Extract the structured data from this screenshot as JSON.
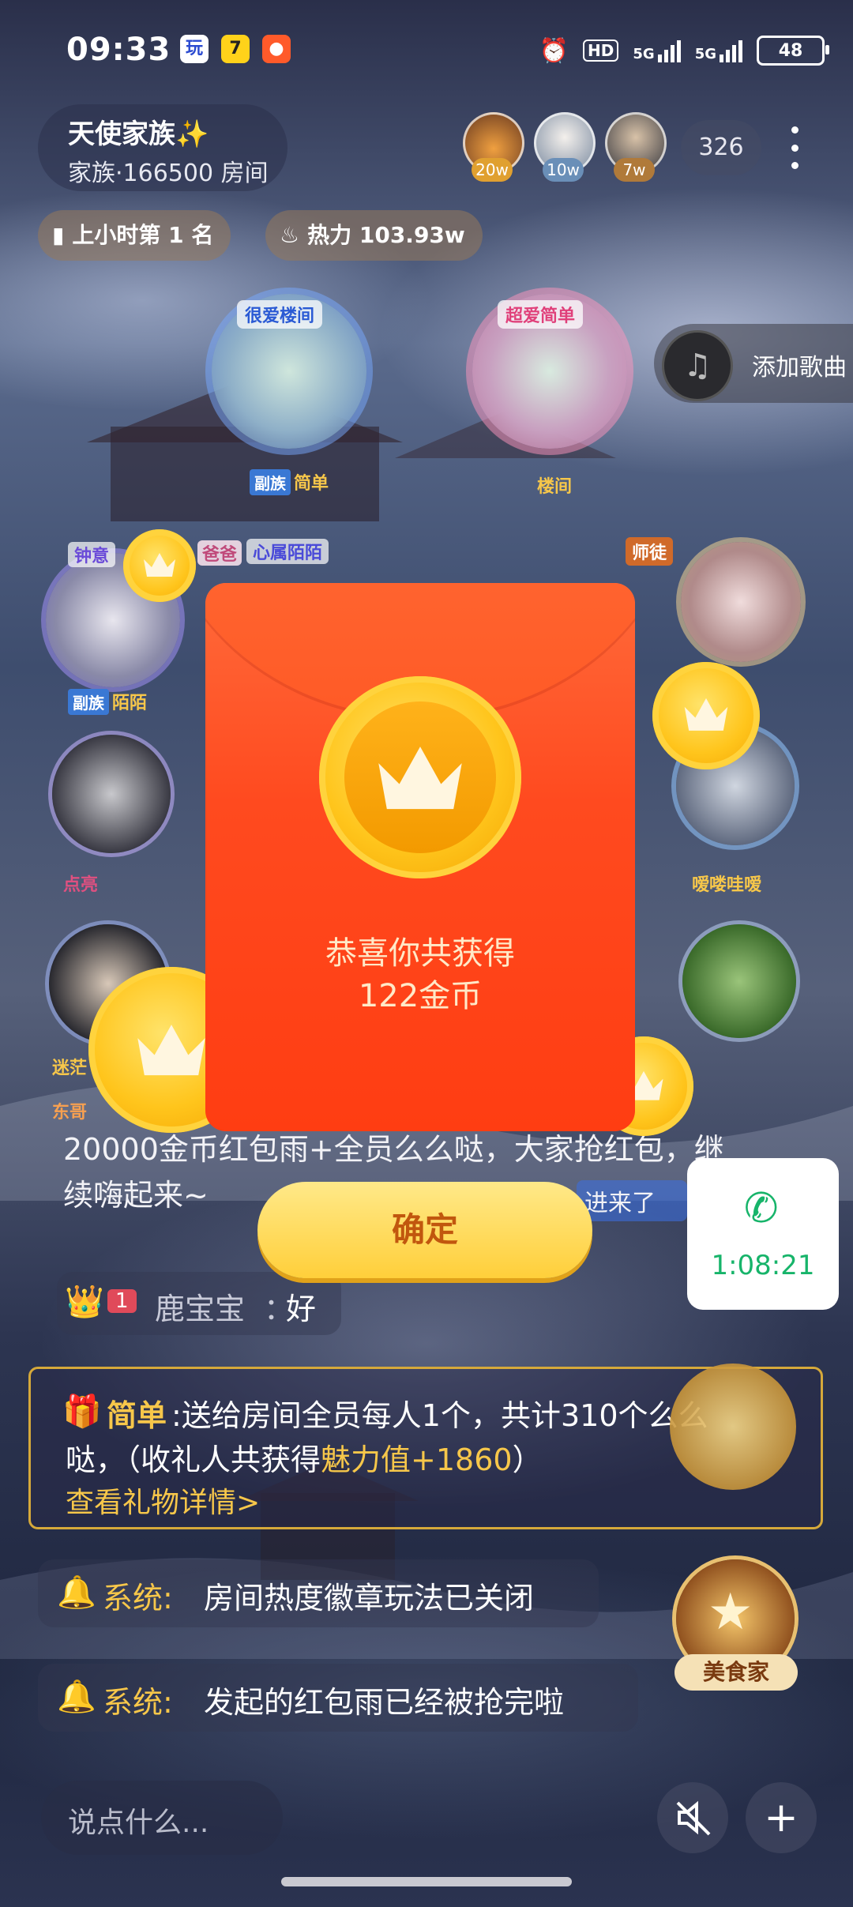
{
  "status_bar": {
    "time": "09:33",
    "app_icons": [
      "玩",
      "7"
    ],
    "hd_label": "HD",
    "net1": "5G",
    "net2": "5G",
    "battery": "48"
  },
  "room": {
    "name": "天使家族✨",
    "sub": "家族·166500 房间",
    "audience_count": "326",
    "top_contributors": [
      {
        "badge": "20w",
        "color": "#e0a030"
      },
      {
        "badge": "10w",
        "color": "#6a8fb8"
      },
      {
        "badge": "7w",
        "color": "#b07a3a"
      }
    ],
    "rank_label": "上小时第 1 名",
    "heat_label": "热力 103.93w"
  },
  "music": {
    "label": "添加歌曲"
  },
  "seats": [
    {
      "frame_title": "很爱楼间",
      "tag": "副族",
      "name": "简单"
    },
    {
      "frame_title": "超爱简单",
      "tag": "",
      "name": "楼间"
    },
    {
      "frame_title": "钟意",
      "tag": "副族",
      "name": "陌陌"
    },
    {
      "frame_title": "心属陌陌",
      "tag": "爸爸",
      "name": ""
    },
    {
      "frame_title": "",
      "tag": "师徒",
      "name": ""
    },
    {
      "frame_title": "",
      "tag": "",
      "name": "嗳喽哇嗳"
    },
    {
      "frame_title": "",
      "tag": "",
      "name": "点亮"
    },
    {
      "frame_title": "",
      "tag": "",
      "name": "迷茫"
    },
    {
      "frame_title": "",
      "tag": "",
      "name": "东哥"
    }
  ],
  "chat": {
    "line1": "20000金币红包雨+全员么么哒，大家抢红包，继",
    "line2": "续嗨起来~",
    "enter_notice": "进来了",
    "user_msg": {
      "level": "1",
      "user": "鹿宝宝",
      "colon": "：",
      "text": "好"
    },
    "gift": {
      "sender": "简单",
      "text1": ":送给房间全员每人1个，共计310个么么",
      "text2a": "哒，（收礼人共获得",
      "text2b": "魅力值+1860",
      "text2c": "）",
      "link": "查看礼物详情>"
    },
    "system": [
      {
        "label": "系统:",
        "text": "房间热度徽章玩法已关闭"
      },
      {
        "label": "系统:",
        "text": "发起的红包雨已经被抢完啦"
      }
    ]
  },
  "badge_gourmet": "美食家",
  "call": {
    "timer": "1:08:21"
  },
  "dialog": {
    "line1": "恭喜你共获得",
    "line2": "122金币",
    "confirm": "确定"
  },
  "input": {
    "placeholder": "说点什么..."
  },
  "icons": {
    "mute": "speaker-muted-icon",
    "add": "plus-icon",
    "phone": "phone-icon",
    "music": "music-note-icon",
    "crown": "crown-icon"
  }
}
